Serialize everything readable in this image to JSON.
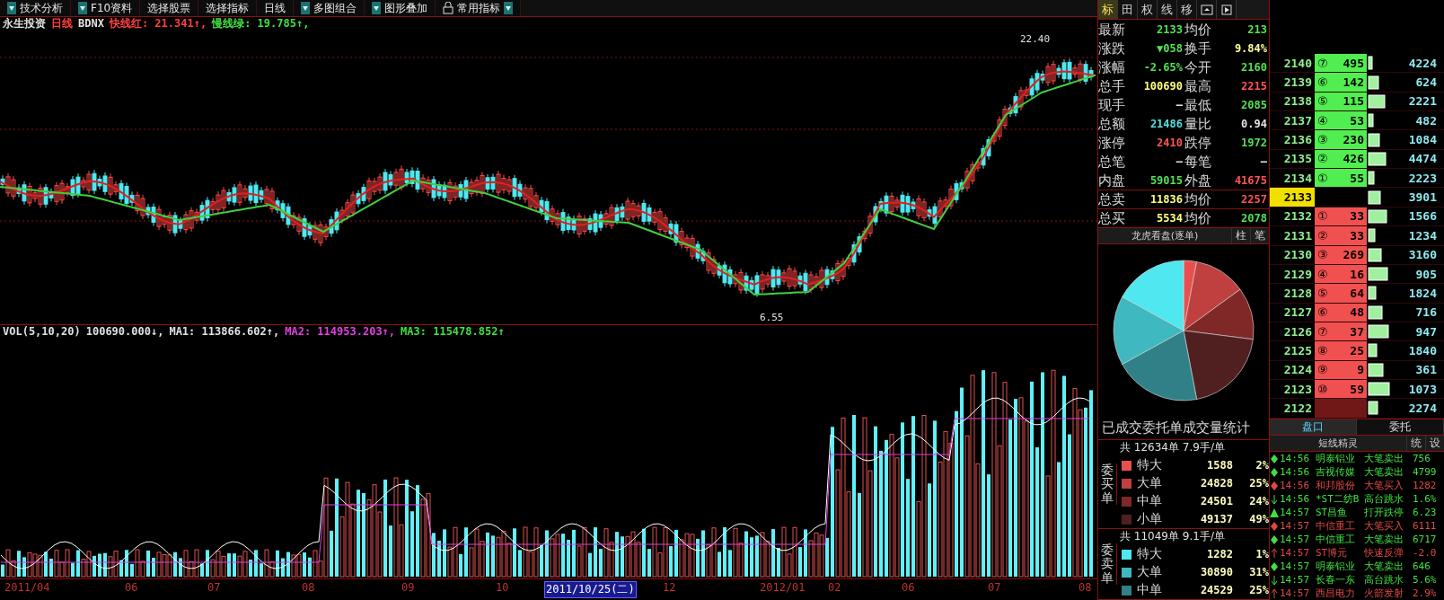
{
  "toolbar": [
    {
      "label": "技术分析",
      "kind": "dropdown"
    },
    {
      "label": "F10资料",
      "kind": "dropdown"
    },
    {
      "label": "选择股票",
      "kind": "plain"
    },
    {
      "label": "选择指标",
      "kind": "plain"
    },
    {
      "label": "日线",
      "kind": "plain"
    },
    {
      "label": "多图组合",
      "kind": "dropdown"
    },
    {
      "label": "图形叠加",
      "kind": "dropdown"
    },
    {
      "label": "常用指标",
      "kind": "pinned"
    }
  ],
  "chart_info": [
    {
      "text": "永生投资",
      "color": "#e0e0e0"
    },
    {
      "text": "日线",
      "color": "#ff4040"
    },
    {
      "text": "BDNX",
      "color": "#e0e0e0"
    },
    {
      "text": "快线红: 21.341↑,",
      "color": "#ff4040"
    },
    {
      "text": "慢线绿: 19.785↑,",
      "color": "#40e040"
    }
  ],
  "price_labels": {
    "high": "22.40",
    "low": "6.55"
  },
  "vol_info": [
    {
      "text": "VOL(5,10,20)",
      "color": "#e0e0e0"
    },
    {
      "text": "100690.000↓,",
      "color": "#e0e0e0"
    },
    {
      "text": "MA1: 113866.602↑,",
      "color": "#e0e0e0"
    },
    {
      "text": "MA2: 114953.203↑,",
      "color": "#e040e0"
    },
    {
      "text": "MA3: 115478.852↑",
      "color": "#40e040"
    }
  ],
  "x_axis": [
    {
      "label": "2011/04",
      "selected": false
    },
    {
      "label": "06",
      "selected": false
    },
    {
      "label": "07",
      "selected": false
    },
    {
      "label": "08",
      "selected": false
    },
    {
      "label": "09",
      "selected": false
    },
    {
      "label": "10",
      "selected": false
    },
    {
      "label": "2011/10/25(二)",
      "selected": true
    },
    {
      "label": "12",
      "selected": false
    },
    {
      "label": "2012/01",
      "selected": false
    },
    {
      "label": "02",
      "selected": false
    },
    {
      "label": "06",
      "selected": false
    },
    {
      "label": "07",
      "selected": false
    },
    {
      "label": "08",
      "selected": false
    }
  ],
  "quote_tabs": [
    {
      "label": "标",
      "selected": true
    },
    {
      "label": "田",
      "selected": false
    },
    {
      "label": "权",
      "selected": false
    },
    {
      "label": "线",
      "selected": false
    },
    {
      "label": "移",
      "selected": false
    }
  ],
  "quote_rows": [
    {
      "boxed": false,
      "cells": [
        {
          "label": "最新",
          "value": "2133",
          "color": "#54e054"
        },
        {
          "label": "均价",
          "value": "213",
          "color": "#54e054"
        }
      ]
    },
    {
      "boxed": false,
      "cells": [
        {
          "label": "涨跌",
          "value": "▼058",
          "color": "#54e054"
        },
        {
          "label": "换手",
          "value": "9.84%",
          "color": "#ffff99"
        }
      ]
    },
    {
      "boxed": false,
      "cells": [
        {
          "label": "涨幅",
          "value": "-2.65%",
          "color": "#54e054"
        },
        {
          "label": "今开",
          "value": "2160",
          "color": "#54e054"
        }
      ]
    },
    {
      "boxed": false,
      "cells": [
        {
          "label": "总手",
          "value": "100690",
          "color": "#ffff80"
        },
        {
          "label": "最高",
          "value": "2215",
          "color": "#ff5454"
        }
      ]
    },
    {
      "boxed": false,
      "cells": [
        {
          "label": "现手",
          "value": "–",
          "color": "#e0e0e0"
        },
        {
          "label": "最低",
          "value": "2085",
          "color": "#54e054"
        }
      ]
    },
    {
      "boxed": false,
      "cells": [
        {
          "label": "总额",
          "value": "21486",
          "color": "#54e0e0"
        },
        {
          "label": "量比",
          "value": "0.94",
          "color": "#e0e0e0"
        }
      ]
    },
    {
      "boxed": false,
      "cells": [
        {
          "label": "涨停",
          "value": "2410",
          "color": "#ff5454"
        },
        {
          "label": "跌停",
          "value": "1972",
          "color": "#54e054"
        }
      ]
    },
    {
      "boxed": false,
      "cells": [
        {
          "label": "总笔",
          "value": "–",
          "color": "#e0e0e0"
        },
        {
          "label": "每笔",
          "value": "–",
          "color": "#e0e0e0"
        }
      ]
    },
    {
      "boxed": false,
      "cells": [
        {
          "label": "内盘",
          "value": "59015",
          "color": "#54e054"
        },
        {
          "label": "外盘",
          "value": "41675",
          "color": "#ff5454"
        }
      ]
    },
    {
      "boxed": true,
      "cells": [
        {
          "label": "总卖",
          "value": "11836",
          "color": "#ffff80"
        },
        {
          "label": "均价",
          "value": "2257",
          "color": "#ff5454"
        }
      ]
    },
    {
      "boxed": true,
      "cells": [
        {
          "label": "总买",
          "value": "5534",
          "color": "#ffff80"
        },
        {
          "label": "均价",
          "value": "2078",
          "color": "#54e054"
        }
      ]
    }
  ],
  "dragon_header": {
    "title": "龙虎看盘(逐单)",
    "buttons": [
      "柱",
      "笔"
    ]
  },
  "stats_title": "已成交委托单成交量统计",
  "stats_groups": [
    {
      "side": "委买单",
      "summary": "共 12634单 7.9手/单",
      "items": [
        {
          "label": "特大",
          "value": "1588",
          "pct": "2%",
          "color": "#e85050"
        },
        {
          "label": "大单",
          "value": "24828",
          "pct": "25%",
          "color": "#c04040"
        },
        {
          "label": "中单",
          "value": "24501",
          "pct": "24%",
          "color": "#802828"
        },
        {
          "label": "小单",
          "value": "49137",
          "pct": "49%",
          "color": "#502020"
        }
      ]
    },
    {
      "side": "委卖单",
      "summary": "共 11049单 9.1手/单",
      "items": [
        {
          "label": "特大",
          "value": "1282",
          "pct": "1%",
          "color": "#50e8f0"
        },
        {
          "label": "大单",
          "value": "30890",
          "pct": "31%",
          "color": "#40b8c0"
        },
        {
          "label": "中单",
          "value": "24529",
          "pct": "25%",
          "color": "#308088"
        }
      ]
    }
  ],
  "order_book": [
    {
      "kind": "ask",
      "price": "2140",
      "rank": "⑦",
      "volume": "495",
      "total": "4224"
    },
    {
      "kind": "ask",
      "price": "2139",
      "rank": "⑥",
      "volume": "142",
      "total": "624"
    },
    {
      "kind": "ask",
      "price": "2138",
      "rank": "⑤",
      "volume": "115",
      "total": "2221"
    },
    {
      "kind": "ask",
      "price": "2137",
      "rank": "④",
      "volume": "53",
      "total": "482"
    },
    {
      "kind": "ask",
      "price": "2136",
      "rank": "③",
      "volume": "230",
      "total": "1084"
    },
    {
      "kind": "ask",
      "price": "2135",
      "rank": "②",
      "volume": "426",
      "total": "4474"
    },
    {
      "kind": "ask",
      "price": "2134",
      "rank": "①",
      "volume": "55",
      "total": "2223"
    },
    {
      "kind": "current",
      "price": "2133",
      "total": "3901"
    },
    {
      "kind": "bid",
      "price": "2132",
      "rank": "①",
      "volume": "33",
      "total": "1566"
    },
    {
      "kind": "bid",
      "price": "2131",
      "rank": "②",
      "volume": "33",
      "total": "1234"
    },
    {
      "kind": "bid",
      "price": "2130",
      "rank": "③",
      "volume": "269",
      "total": "3160"
    },
    {
      "kind": "bid",
      "price": "2129",
      "rank": "④",
      "volume": "16",
      "total": "905"
    },
    {
      "kind": "bid",
      "price": "2128",
      "rank": "⑤",
      "volume": "64",
      "total": "1824"
    },
    {
      "kind": "bid",
      "price": "2127",
      "rank": "⑥",
      "volume": "48",
      "total": "716"
    },
    {
      "kind": "bid",
      "price": "2126",
      "rank": "⑦",
      "volume": "37",
      "total": "947"
    },
    {
      "kind": "bid",
      "price": "2125",
      "rank": "⑧",
      "volume": "25",
      "total": "1840"
    },
    {
      "kind": "bid",
      "price": "2124",
      "rank": "⑨",
      "volume": "9",
      "total": "361"
    },
    {
      "kind": "bid",
      "price": "2123",
      "rank": "⑩",
      "volume": "59",
      "total": "1073"
    },
    {
      "kind": "other",
      "price": "2122",
      "total": "2274"
    }
  ],
  "book_tabs": [
    {
      "label": "盘口",
      "selected": true
    },
    {
      "label": "委托",
      "selected": false
    }
  ],
  "alerts_header": {
    "title": "短线精灵",
    "buttons": [
      "统",
      "设"
    ]
  },
  "alerts": [
    {
      "kind": "diamond",
      "color": "#40e040",
      "time": "14:56",
      "name": "明泰铝业",
      "event": "大笔卖出",
      "value": "756"
    },
    {
      "kind": "diamond",
      "color": "#40e040",
      "time": "14:56",
      "name": "吉视传媒",
      "event": "大笔卖出",
      "value": "4799"
    },
    {
      "kind": "diamond",
      "color": "#e04848",
      "time": "14:56",
      "name": "和邦股份",
      "event": "大笔买入",
      "value": "1282"
    },
    {
      "kind": "down",
      "color": "#40e040",
      "time": "14:56",
      "name": "*ST二纺B",
      "event": "高台跳水",
      "value": "1.6%"
    },
    {
      "kind": "triangle",
      "color": "#40e040",
      "time": "14:57",
      "name": "ST昌鱼",
      "event": "打开跌停",
      "value": "6.23"
    },
    {
      "kind": "diamond",
      "color": "#e04848",
      "time": "14:57",
      "name": "中信重工",
      "event": "大笔买入",
      "value": "6111"
    },
    {
      "kind": "diamond",
      "color": "#40e040",
      "time": "14:57",
      "name": "中信重工",
      "event": "大笔卖出",
      "value": "6717"
    },
    {
      "kind": "up",
      "color": "#e04848",
      "time": "14:57",
      "name": "ST博元",
      "event": "快速反弹",
      "value": "-2.0"
    },
    {
      "kind": "diamond",
      "color": "#40e040",
      "time": "14:57",
      "name": "明泰铝业",
      "event": "大笔卖出",
      "value": "646"
    },
    {
      "kind": "down",
      "color": "#40e040",
      "time": "14:57",
      "name": "长春一东",
      "event": "高台跳水",
      "value": "5.6%"
    },
    {
      "kind": "up",
      "color": "#e04848",
      "time": "14:57",
      "name": "西昌电力",
      "event": "火箭发射",
      "value": "2.9%"
    }
  ]
}
